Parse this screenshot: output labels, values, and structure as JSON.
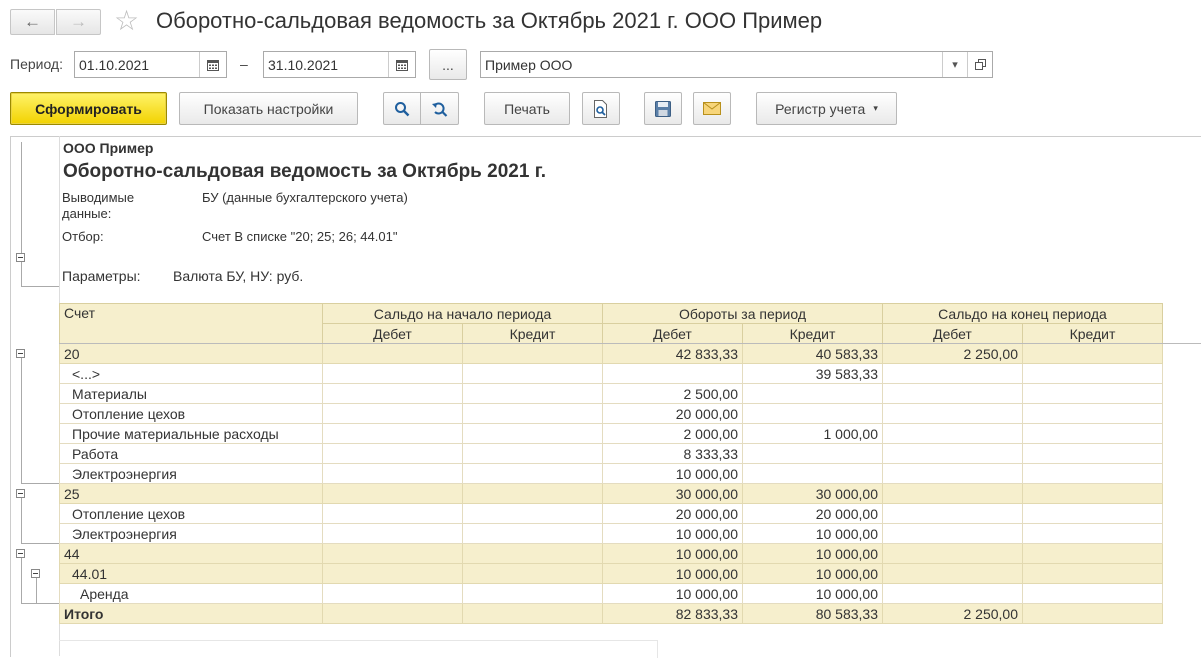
{
  "window": {
    "title": "Оборотно-сальдовая ведомость за Октябрь 2021 г. ООО Пример",
    "back_glyph": "←",
    "forward_glyph": "→",
    "favorite_glyph": "☆"
  },
  "filters": {
    "period_label": "Период:",
    "date_from": "01.10.2021",
    "dash": "–",
    "date_to": "31.10.2021",
    "more_label": "...",
    "organization": "Пример ООО"
  },
  "toolbar": {
    "generate_label": "Сформировать",
    "settings_label": "Показать настройки",
    "print_label": "Печать",
    "register_label": "Регистр учета"
  },
  "report": {
    "org": "ООО Пример",
    "title": "Оборотно-сальдовая ведомость за Октябрь 2021 г.",
    "output_label": "Выводимые данные:",
    "output_value": "БУ (данные бухгалтерского учета)",
    "filter_label": "Отбор:",
    "filter_value": "Счет В списке \"20; 25; 26; 44.01\"",
    "params_label": "Параметры:",
    "params_value": "Валюта БУ, НУ: руб.",
    "headers": {
      "account": "Счет",
      "opening": "Сальдо на начало периода",
      "turnover": "Обороты за период",
      "closing": "Сальдо на конец периода",
      "debit": "Дебет",
      "credit": "Кредит"
    },
    "rows": [
      {
        "kind": "grp",
        "account": "20",
        "indent": 0,
        "od": "",
        "oc": "",
        "td": "42 833,33",
        "tc": "40 583,33",
        "cd": "2 250,00",
        "cc": ""
      },
      {
        "kind": "plain",
        "account": "<...>",
        "indent": 1,
        "od": "",
        "oc": "",
        "td": "",
        "tc": "39 583,33",
        "cd": "",
        "cc": ""
      },
      {
        "kind": "plain",
        "account": "Материалы",
        "indent": 1,
        "od": "",
        "oc": "",
        "td": "2 500,00",
        "tc": "",
        "cd": "",
        "cc": ""
      },
      {
        "kind": "plain",
        "account": "Отопление цехов",
        "indent": 1,
        "od": "",
        "oc": "",
        "td": "20 000,00",
        "tc": "",
        "cd": "",
        "cc": ""
      },
      {
        "kind": "plain",
        "account": "Прочие материальные расходы",
        "indent": 1,
        "od": "",
        "oc": "",
        "td": "2 000,00",
        "tc": "1 000,00",
        "cd": "",
        "cc": ""
      },
      {
        "kind": "plain",
        "account": "Работа",
        "indent": 1,
        "od": "",
        "oc": "",
        "td": "8 333,33",
        "tc": "",
        "cd": "",
        "cc": ""
      },
      {
        "kind": "plain",
        "account": "Электроэнергия",
        "indent": 1,
        "od": "",
        "oc": "",
        "td": "10 000,00",
        "tc": "",
        "cd": "",
        "cc": ""
      },
      {
        "kind": "grp",
        "account": "25",
        "indent": 0,
        "od": "",
        "oc": "",
        "td": "30 000,00",
        "tc": "30 000,00",
        "cd": "",
        "cc": ""
      },
      {
        "kind": "plain",
        "account": "Отопление цехов",
        "indent": 1,
        "od": "",
        "oc": "",
        "td": "20 000,00",
        "tc": "20 000,00",
        "cd": "",
        "cc": ""
      },
      {
        "kind": "plain",
        "account": "Электроэнергия",
        "indent": 1,
        "od": "",
        "oc": "",
        "td": "10 000,00",
        "tc": "10 000,00",
        "cd": "",
        "cc": ""
      },
      {
        "kind": "grp",
        "account": "44",
        "indent": 0,
        "od": "",
        "oc": "",
        "td": "10 000,00",
        "tc": "10 000,00",
        "cd": "",
        "cc": ""
      },
      {
        "kind": "grp",
        "account": "44.01",
        "indent": 1,
        "od": "",
        "oc": "",
        "td": "10 000,00",
        "tc": "10 000,00",
        "cd": "",
        "cc": ""
      },
      {
        "kind": "plain",
        "account": "Аренда",
        "indent": 2,
        "od": "",
        "oc": "",
        "td": "10 000,00",
        "tc": "10 000,00",
        "cd": "",
        "cc": ""
      },
      {
        "kind": "tot",
        "account": "Итого",
        "indent": 0,
        "od": "",
        "oc": "",
        "td": "82 833,33",
        "tc": "80 583,33",
        "cd": "2 250,00",
        "cc": ""
      }
    ]
  },
  "icons": {
    "calendar": "calendar-icon",
    "search": "search-icon",
    "search_refresh": "search-refresh-icon",
    "preview": "print-preview-icon",
    "save": "save-icon",
    "mail": "mail-icon",
    "dropdown": "dropdown-arrow-icon",
    "open": "open-icon"
  }
}
